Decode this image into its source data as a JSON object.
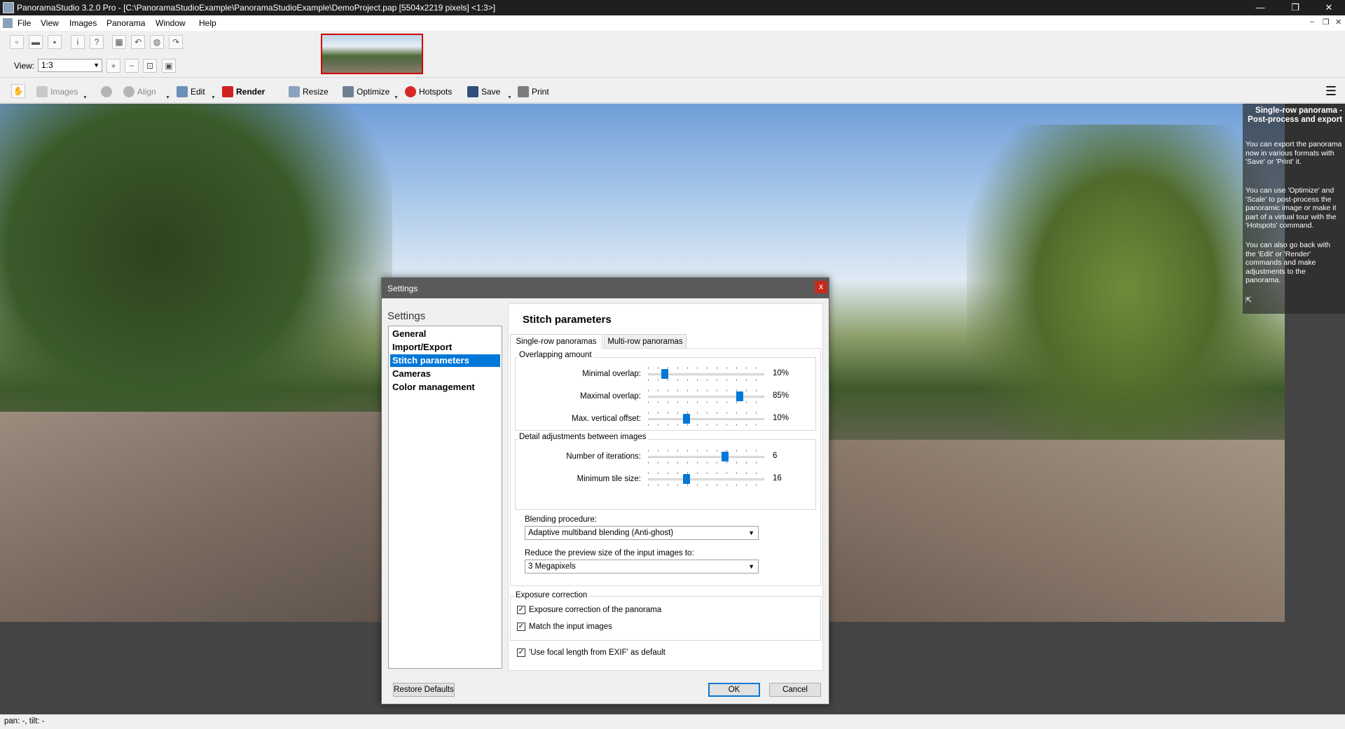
{
  "window": {
    "title": "PanoramaStudio 3.2.0 Pro - [C:\\PanoramaStudioExample\\PanoramaStudioExample\\DemoProject.pap [5504x2219 pixels] <1:3>]",
    "minimize": "—",
    "restore": "❐",
    "close": "✕"
  },
  "menu": {
    "items": [
      "File",
      "View",
      "Images",
      "Panorama",
      "Window",
      "Help"
    ],
    "mdi_minimize": "–",
    "mdi_restore": "❐",
    "mdi_close": "✕"
  },
  "view": {
    "label": "View:",
    "value": "1:3"
  },
  "toolbar": {
    "items": [
      {
        "label": "Images",
        "icon": "images-icon",
        "disabled": true
      },
      {
        "label": "Align",
        "icon": "align-icon",
        "disabled": true
      },
      {
        "label": "Edit",
        "icon": "edit-icon",
        "disabled": false
      },
      {
        "label": "Render",
        "icon": "render-icon",
        "disabled": false,
        "bold": true
      },
      {
        "label": "Resize",
        "icon": "resize-icon",
        "disabled": false
      },
      {
        "label": "Optimize",
        "icon": "optimize-icon",
        "disabled": false
      },
      {
        "label": "Hotspots",
        "icon": "hotspots-icon",
        "disabled": false
      },
      {
        "label": "Save",
        "icon": "save-icon",
        "disabled": false
      },
      {
        "label": "Print",
        "icon": "print-icon",
        "disabled": false
      }
    ],
    "menu_icon": "☰"
  },
  "info_panel": {
    "title": "Single-row panorama - Post-process and export",
    "paragraphs": [
      "You can export the panorama now in various formats with 'Save' or 'Print' it.",
      "You can use 'Optimize' and 'Scale' to post-process the panoramic image or make it part of a virtual tour with the 'Hotspots' command.",
      "You can also go back with the 'Edit' or 'Render' commands and make adjustments to the panorama."
    ],
    "pin_icon": "⇱"
  },
  "status": {
    "text": "pan: -, tilt: -"
  },
  "dialog": {
    "title": "Settings",
    "close": "x",
    "heading": "Settings",
    "nav": [
      "General",
      "Import/Export",
      "Stitch parameters",
      "Cameras",
      "Color management"
    ],
    "selected_nav": 2,
    "panel_title": "Stitch parameters",
    "tabs": [
      "Single-row panoramas",
      "Multi-row panoramas"
    ],
    "overlap_group": {
      "label": "Overlapping amount",
      "rows": [
        {
          "label": "Minimal overlap:",
          "value": "10%",
          "fraction": 0.12
        },
        {
          "label": "Maximal overlap:",
          "value": "85%",
          "fraction": 0.81
        },
        {
          "label": "Max. vertical offset:",
          "value": "10%",
          "fraction": 0.32
        }
      ]
    },
    "detail_group": {
      "label": "Detail adjustments between images",
      "rows": [
        {
          "label": "Number of iterations:",
          "value": "6",
          "fraction": 0.67
        },
        {
          "label": "Minimum tile size:",
          "value": "16",
          "fraction": 0.32
        }
      ]
    },
    "blending": {
      "label": "Blending procedure:",
      "value": "Adaptive multiband blending (Anti-ghost)"
    },
    "preview": {
      "label": "Reduce the preview size of the input images to:",
      "value": "3 Megapixels"
    },
    "exposure_group": {
      "label": "Exposure correction",
      "checks": [
        {
          "label": "Exposure correction of the panorama",
          "checked": true
        },
        {
          "label": "Match the input images",
          "checked": true
        }
      ]
    },
    "focal": {
      "label": "'Use focal length from EXIF' as default",
      "checked": true
    },
    "buttons": {
      "restore": "Restore Defaults",
      "ok": "OK",
      "cancel": "Cancel"
    }
  }
}
